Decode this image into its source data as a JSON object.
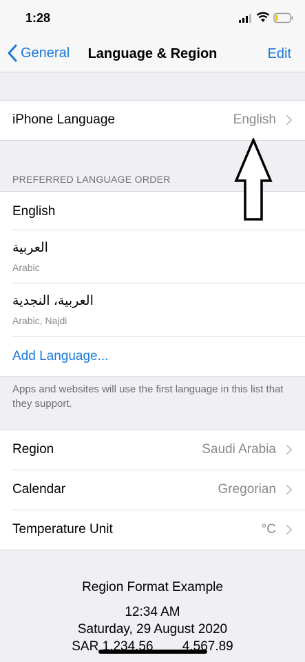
{
  "status_bar": {
    "time": "1:28",
    "icons": [
      "cellular-signal-icon",
      "wifi-icon",
      "battery-icon"
    ]
  },
  "nav": {
    "back_label": "General",
    "title": "Language & Region",
    "edit_label": "Edit"
  },
  "iphone_language": {
    "label": "iPhone Language",
    "value": "English"
  },
  "preferred": {
    "header": "PREFERRED LANGUAGE ORDER",
    "languages": [
      {
        "name": "English",
        "subtitle": ""
      },
      {
        "name": "العربية",
        "subtitle": "Arabic"
      },
      {
        "name": "العربية، النجدية",
        "subtitle": "Arabic, Najdi"
      }
    ],
    "add_label": "Add Language...",
    "footer": "Apps and websites will use the first language in this list that they support."
  },
  "settings": [
    {
      "label": "Region",
      "value": "Saudi Arabia"
    },
    {
      "label": "Calendar",
      "value": "Gregorian"
    },
    {
      "label": "Temperature Unit",
      "value": "°C"
    }
  ],
  "format_example": {
    "title": "Region Format Example",
    "time": "12:34 AM",
    "date": "Saturday, 29 August 2020",
    "numbers": "SAR 1,234.56        4,567.89"
  },
  "colors": {
    "accent": "#1a7ad8",
    "background": "#efeff4",
    "secondary_text": "#8a8a8e"
  }
}
